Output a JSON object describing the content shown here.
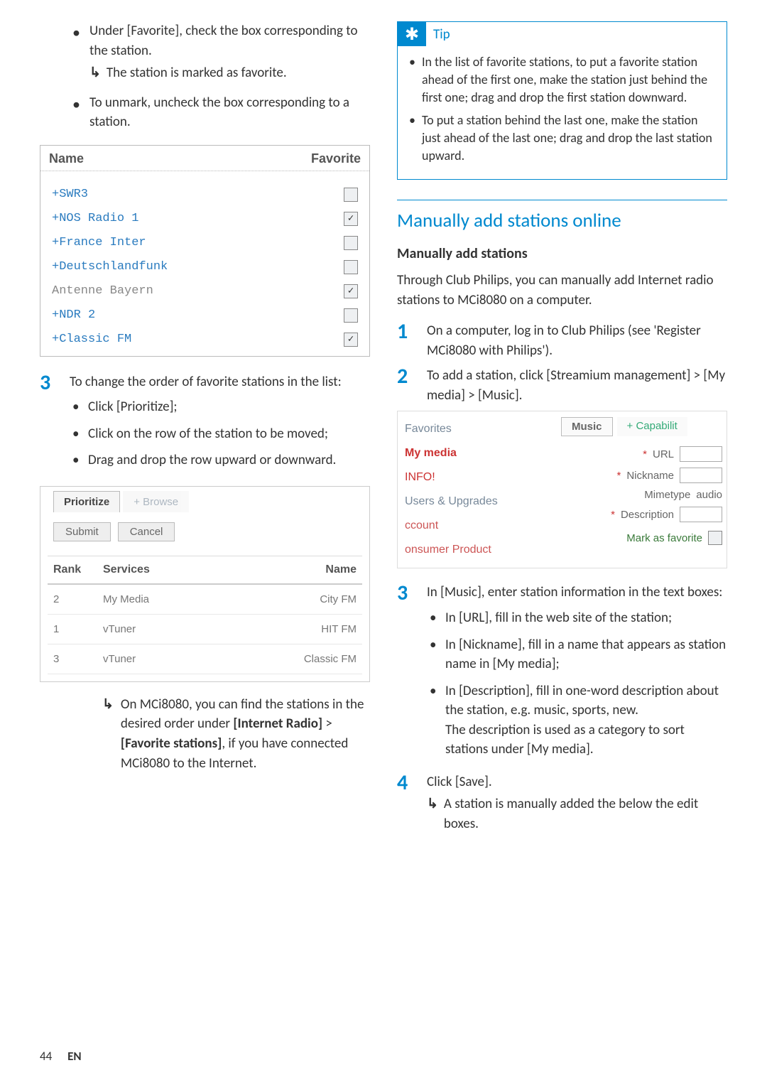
{
  "left": {
    "intro_bullet1a": "Under [Favorite], check the box corresponding to the station.",
    "intro_bullet1_result": "The station is marked as favorite.",
    "intro_bullet2": "To unmark, uncheck the box corresponding to a station.",
    "fav_table": {
      "h_name": "Name",
      "h_fav": "Favorite",
      "rows": [
        {
          "name": "+SWR3",
          "checked": false,
          "cls": ""
        },
        {
          "name": "+NOS Radio 1",
          "checked": true,
          "cls": ""
        },
        {
          "name": "+France Inter",
          "checked": false,
          "cls": ""
        },
        {
          "name": "+Deutschlandfunk",
          "checked": false,
          "cls": ""
        },
        {
          "name": "Antenne Bayern",
          "checked": true,
          "cls": "gray"
        },
        {
          "name": "+NDR 2",
          "checked": false,
          "cls": ""
        },
        {
          "name": "+Classic FM",
          "checked": true,
          "cls": ""
        }
      ]
    },
    "step3": {
      "num": "3",
      "lead": "To change the order of favorite stations in the list:",
      "bullets": [
        "Click [Prioritize];",
        "Click on the row of the station to be moved;",
        "Drag and drop the row upward or downward."
      ]
    },
    "prio": {
      "tab1": "Prioritize",
      "tab2": "+ Browse",
      "btn_submit": "Submit",
      "btn_cancel": "Cancel",
      "h_rank": "Rank",
      "h_serv": "Services",
      "h_name": "Name",
      "rows": [
        {
          "rank": "2",
          "serv": "My Media",
          "name": "City FM"
        },
        {
          "rank": "1",
          "serv": "vTuner",
          "name": "HIT FM"
        },
        {
          "rank": "3",
          "serv": "vTuner",
          "name": "Classic FM"
        }
      ]
    },
    "result_text_1": "On MCi8080, you can find the stations in the desired order under ",
    "result_bold_1": "[Internet Radio]",
    "result_text_2": " > ",
    "result_bold_2": "[Favorite stations]",
    "result_text_3": ", if you have connected MCi8080 to the Internet."
  },
  "right": {
    "tip_title": "Tip",
    "tip_items": [
      "In the list of favorite stations, to put a favorite station ahead of the first one, make the station just behind the first one; drag and drop the first station downward.",
      "To put a station behind the last one, make the station just ahead of the last one; drag and drop the last station upward."
    ],
    "section_title": "Manually add stations online",
    "sub_title": "Manually add stations",
    "intro_para": "Through Club Philips, you can manually add Internet radio stations to MCi8080 on a computer.",
    "step1": {
      "num": "1",
      "text": "On a computer, log in to Club Philips (see 'Register MCi8080 with Philips')."
    },
    "step2": {
      "num": "2",
      "text": "To add a station, click [Streamium management] > [My media] > [Music]."
    },
    "club": {
      "left_items": {
        "fav": "Favorites",
        "my": "My media",
        "info": "INFO!",
        "uu": "Users & Upgrades",
        "acc": "ccount",
        "con": "onsumer Product"
      },
      "tab_music": "Music",
      "tab_cap": "+ Capabilit",
      "f_url": "URL",
      "f_nick": "Nickname",
      "f_mime": "Mimetype",
      "f_mime_v": "audio",
      "f_desc": "Description",
      "f_mark": "Mark as favorite"
    },
    "step3": {
      "num": "3",
      "lead": "In [Music], enter station information in the text boxes:",
      "bullets": [
        "In [URL], fill in the web site of the station;",
        "In [Nickname], fill in a name that appears as station name in [My media];",
        "In [Description], fill in one-word description about the station, e.g. music, sports, new.\nThe description is used as a category to sort stations under [My media]."
      ]
    },
    "step4": {
      "num": "4",
      "text": "Click [Save].",
      "result": "A station is manually added the below the edit boxes."
    }
  },
  "footer": {
    "page": "44",
    "lang": "EN"
  }
}
